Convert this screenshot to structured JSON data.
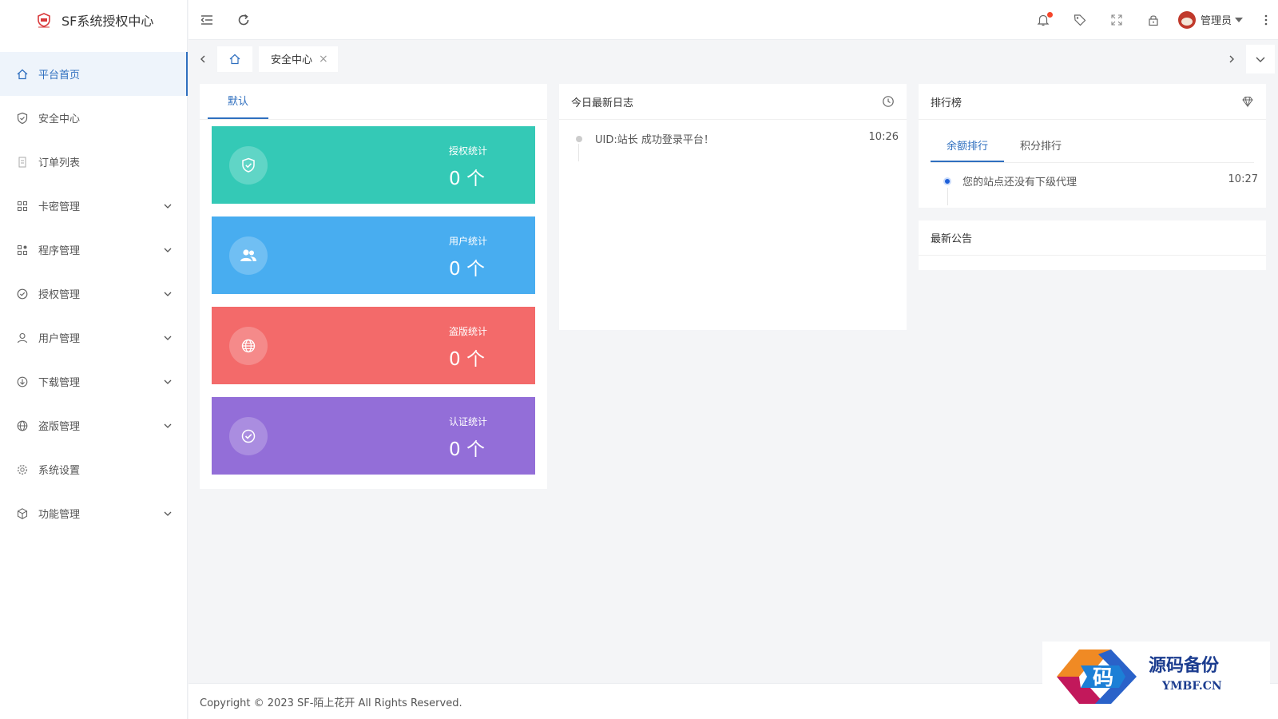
{
  "app": {
    "title": "SF系统授权中心"
  },
  "sidebar": {
    "items": [
      {
        "label": "平台首页",
        "icon": "home-icon",
        "active": true,
        "expandable": false
      },
      {
        "label": "安全中心",
        "icon": "shield-icon",
        "active": false,
        "expandable": false
      },
      {
        "label": "订单列表",
        "icon": "list-icon",
        "active": false,
        "expandable": false
      },
      {
        "label": "卡密管理",
        "icon": "grid-icon",
        "active": false,
        "expandable": true
      },
      {
        "label": "程序管理",
        "icon": "apps-icon",
        "active": false,
        "expandable": true
      },
      {
        "label": "授权管理",
        "icon": "check-circle-icon",
        "active": false,
        "expandable": true
      },
      {
        "label": "用户管理",
        "icon": "user-icon",
        "active": false,
        "expandable": true
      },
      {
        "label": "下载管理",
        "icon": "download-icon",
        "active": false,
        "expandable": true
      },
      {
        "label": "盗版管理",
        "icon": "globe-icon",
        "active": false,
        "expandable": true
      },
      {
        "label": "系统设置",
        "icon": "gear-icon",
        "active": false,
        "expandable": false
      },
      {
        "label": "功能管理",
        "icon": "cube-icon",
        "active": false,
        "expandable": true
      }
    ]
  },
  "header": {
    "user_name": "管理员"
  },
  "tabs": {
    "open": [
      {
        "label": "安全中心",
        "close": "×"
      }
    ]
  },
  "stats_card": {
    "tab_label": "默认",
    "stats": [
      {
        "label": "授权统计",
        "value": "0 个",
        "color": "#34c9b6",
        "icon": "shield-icon"
      },
      {
        "label": "用户统计",
        "value": "0 个",
        "color": "#48adf0",
        "icon": "users-icon"
      },
      {
        "label": "盗版统计",
        "value": "0 个",
        "color": "#f36a6a",
        "icon": "globe-icon"
      },
      {
        "label": "认证统计",
        "value": "0 个",
        "color": "#936ed8",
        "icon": "check-circle-icon"
      }
    ]
  },
  "log_card": {
    "title": "今日最新日志",
    "items": [
      {
        "text": "UID:站长 成功登录平台！",
        "time": "10:26"
      }
    ]
  },
  "rank_card": {
    "title": "排行榜",
    "tabs": [
      "余额排行",
      "积分排行"
    ],
    "items": [
      {
        "text": "您的站点还没有下级代理",
        "time": "10:27"
      }
    ]
  },
  "notice_card": {
    "title": "最新公告"
  },
  "footer": {
    "copyright": "Copyright © 2023 SF-陌上花开 All Rights Reserved."
  },
  "watermark": {
    "text": "源码备份",
    "sub": "YMBF.CN",
    "mark": "码"
  },
  "colors": {
    "accent": "#2f6fbf",
    "notify_dot": "#f5452a"
  }
}
